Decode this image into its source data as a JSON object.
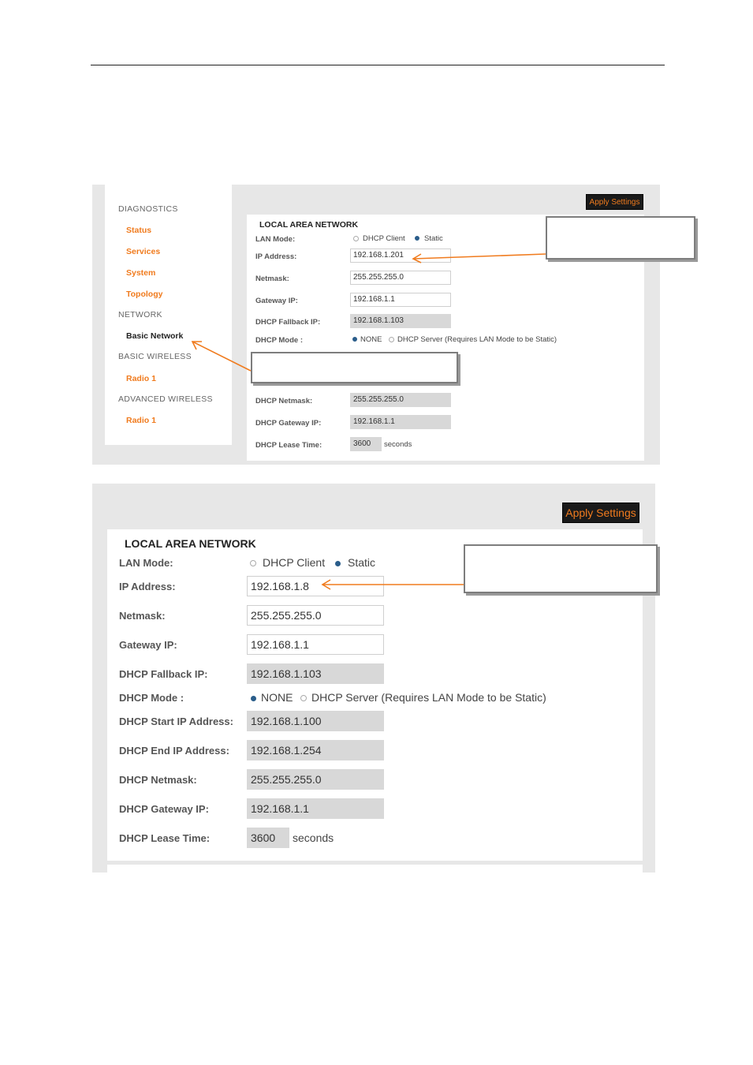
{
  "colors": {
    "accent": "#f07b1e",
    "button_bg": "#1a1a1a",
    "readonly_bg": "#d8d8d8",
    "radio_selected": "#2a5d8a"
  },
  "screenshot1": {
    "sidebar": {
      "diagnostics_header": "DIAGNOSTICS",
      "status": "Status",
      "services": "Services",
      "system": "System",
      "topology": "Topology",
      "network_header": "NETWORK",
      "basic_network": "Basic Network",
      "basic_wireless_header": "BASIC WIRELESS",
      "radio1_basic": "Radio 1",
      "advanced_wireless_header": "ADVANCED WIRELESS",
      "radio1_advanced": "Radio 1"
    },
    "apply_button": "Apply Settings",
    "panel_title": "LOCAL AREA NETWORK",
    "lan_mode": {
      "label": "LAN Mode:",
      "option_dhcp_client": "DHCP Client",
      "option_static": "Static",
      "selected": "Static"
    },
    "ip_address": {
      "label": "IP Address:",
      "value": "192.168.1.201"
    },
    "netmask": {
      "label": "Netmask:",
      "value": "255.255.255.0"
    },
    "gateway_ip": {
      "label": "Gateway IP:",
      "value": "192.168.1.1"
    },
    "dhcp_fallback_ip": {
      "label": "DHCP Fallback IP:",
      "value": "192.168.1.103"
    },
    "dhcp_mode": {
      "label": "DHCP Mode :",
      "option_none": "NONE",
      "option_server": "DHCP Server (Requires LAN Mode to be Static)",
      "selected": "NONE"
    },
    "dhcp_netmask": {
      "label": "DHCP Netmask:",
      "value": "255.255.255.0"
    },
    "dhcp_gateway_ip": {
      "label": "DHCP Gateway IP:",
      "value": "192.168.1.1"
    },
    "dhcp_lease_time": {
      "label": "DHCP Lease Time:",
      "value": "3600",
      "unit": "seconds"
    }
  },
  "screenshot2": {
    "apply_button": "Apply Settings",
    "panel_title": "LOCAL AREA NETWORK",
    "lan_mode": {
      "label": "LAN Mode:",
      "option_dhcp_client": "DHCP Client",
      "option_static": "Static",
      "selected": "Static"
    },
    "ip_address": {
      "label": "IP Address:",
      "value": "192.168.1.8"
    },
    "netmask": {
      "label": "Netmask:",
      "value": "255.255.255.0"
    },
    "gateway_ip": {
      "label": "Gateway IP:",
      "value": "192.168.1.1"
    },
    "dhcp_fallback_ip": {
      "label": "DHCP Fallback IP:",
      "value": "192.168.1.103"
    },
    "dhcp_mode": {
      "label": "DHCP Mode :",
      "option_none": "NONE",
      "option_server": "DHCP Server (Requires LAN Mode to be Static)",
      "selected": "NONE"
    },
    "dhcp_start_ip": {
      "label": "DHCP Start IP Address:",
      "value": "192.168.1.100"
    },
    "dhcp_end_ip": {
      "label": "DHCP End IP Address:",
      "value": "192.168.1.254"
    },
    "dhcp_netmask": {
      "label": "DHCP Netmask:",
      "value": "255.255.255.0"
    },
    "dhcp_gateway_ip": {
      "label": "DHCP Gateway IP:",
      "value": "192.168.1.1"
    },
    "dhcp_lease_time": {
      "label": "DHCP Lease Time:",
      "value": "3600",
      "unit": "seconds"
    }
  }
}
